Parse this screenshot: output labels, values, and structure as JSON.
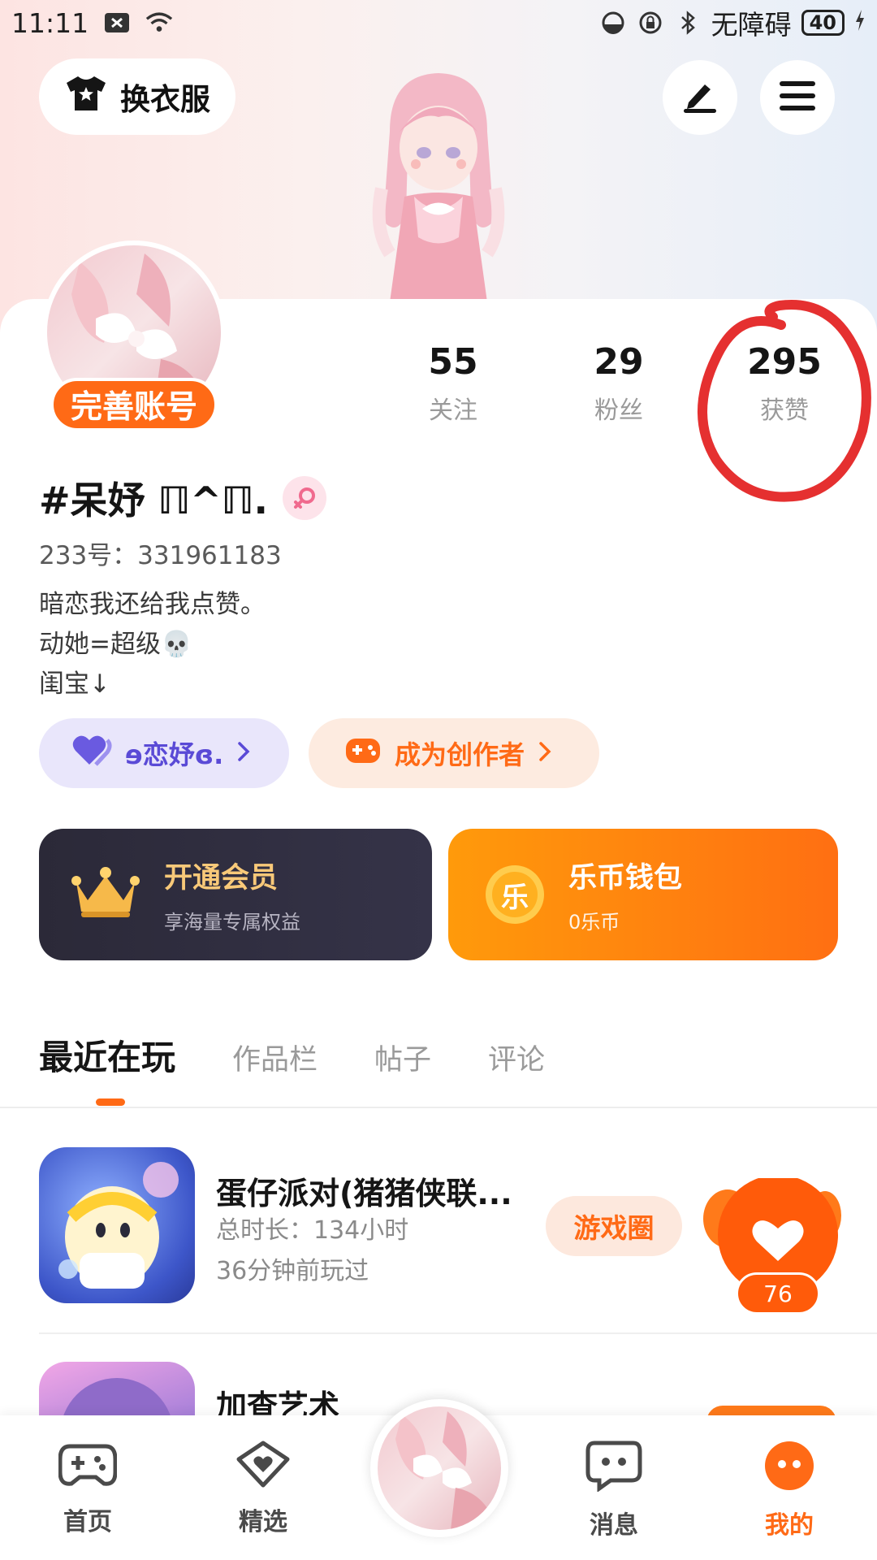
{
  "status_bar": {
    "time": "11:11",
    "accessibility": "无障碍",
    "battery": "40"
  },
  "header": {
    "outfit_label": "换衣服"
  },
  "profile": {
    "complete_label": "完善账号",
    "username": "#呆妤 ℿ^ℿ.",
    "id_text": "233号：331961183",
    "bio": [
      "暗恋我还给我点赞。",
      "动她=超级💀",
      "闺宝↓"
    ]
  },
  "stats": [
    {
      "value": "55",
      "label": "关注"
    },
    {
      "value": "29",
      "label": "粉丝"
    },
    {
      "value": "295",
      "label": "获赞"
    }
  ],
  "pills": {
    "guild": "ɘ恋妤ɞ.",
    "creator": "成为创作者"
  },
  "promo": {
    "vip_title": "开通会员",
    "vip_sub": "享海量专属权益",
    "wallet_title": "乐币钱包",
    "wallet_sub": "0乐币",
    "wallet_coin": "乐"
  },
  "tabs": [
    "最近在玩",
    "作品栏",
    "帖子",
    "评论"
  ],
  "games": [
    {
      "title": "蛋仔派对(猪猪侠联...",
      "duration": "总时长：134小时",
      "last_played": "36分钟前玩过",
      "action": "游戏圈"
    },
    {
      "title": "加查艺术"
    }
  ],
  "like_count": "76",
  "bottom_nav": [
    {
      "label": "首页"
    },
    {
      "label": "精选"
    },
    {
      "label": "消息"
    },
    {
      "label": "我的"
    }
  ],
  "colors": {
    "accent": "#ff6a16",
    "highlight": "#e53030",
    "vip_bg": "#2b2938",
    "guild": "#5a4ad6"
  }
}
